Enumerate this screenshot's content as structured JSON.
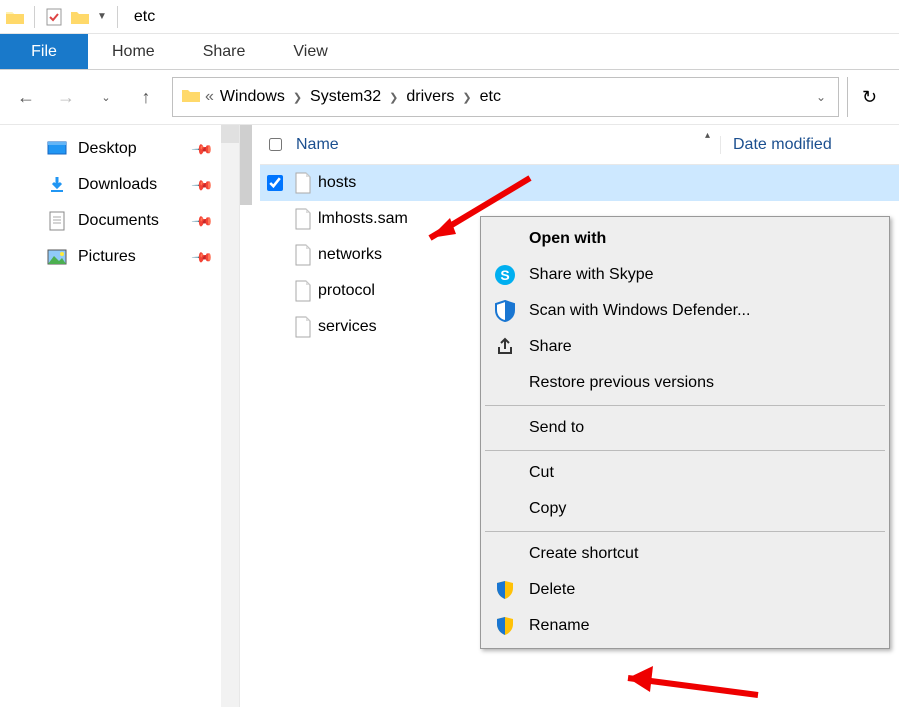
{
  "titlebar": {
    "title": "etc"
  },
  "ribbon": {
    "file": "File",
    "tabs": [
      "Home",
      "Share",
      "View"
    ]
  },
  "breadcrumb": {
    "ellipsis": "«",
    "parts": [
      "Windows",
      "System32",
      "drivers",
      "etc"
    ]
  },
  "sidebar": {
    "items": [
      {
        "label": "Desktop"
      },
      {
        "label": "Downloads"
      },
      {
        "label": "Documents"
      },
      {
        "label": "Pictures"
      }
    ]
  },
  "columns": {
    "name": "Name",
    "date": "Date modified"
  },
  "files": [
    {
      "name": "hosts",
      "selected": true
    },
    {
      "name": "lmhosts.sam",
      "selected": false
    },
    {
      "name": "networks",
      "selected": false
    },
    {
      "name": "protocol",
      "selected": false
    },
    {
      "name": "services",
      "selected": false
    }
  ],
  "context_menu": {
    "open_with": "Open with",
    "skype": "Share with Skype",
    "defender": "Scan with Windows Defender...",
    "share": "Share",
    "restore": "Restore previous versions",
    "sendto": "Send to",
    "cut": "Cut",
    "copy": "Copy",
    "shortcut": "Create shortcut",
    "delete": "Delete",
    "rename": "Rename"
  }
}
